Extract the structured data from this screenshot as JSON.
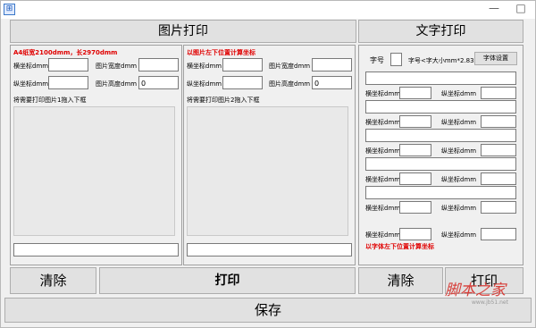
{
  "titlebar": {
    "icon_glyph": "⊞",
    "minimize": "—",
    "maximize": "□",
    "close": "✕"
  },
  "image_print": {
    "title": "图片打印",
    "left": {
      "note": "A4纸宽2100dmm，长2970dmm",
      "x_label": "横坐标dmm",
      "y_label": "纵坐标dmm",
      "w_label": "图片宽度dmm",
      "h_label": "图片高度dmm",
      "h_value": "0",
      "drop_label": "将需要打印图片1拖入下框"
    },
    "right": {
      "note": "以图片左下位置计算坐标",
      "x_label": "横坐标dmm",
      "y_label": "纵坐标dmm",
      "w_label": "图片宽度dmm",
      "h_label": "图片高度dmm",
      "h_value": "0",
      "drop_label": "将需要打印图片2拖入下框"
    }
  },
  "text_print": {
    "title": "文字打印",
    "font_label": "字号",
    "font_hint": "字号<字大小mm*2.835",
    "font_button": "字体设置",
    "x_label": "横坐标dmm",
    "y_label": "纵坐标dmm",
    "note": "以字体左下位置计算坐标"
  },
  "buttons": {
    "clear_left": "清除",
    "print_left": "打印",
    "clear_right": "清除",
    "print_right": "打印",
    "save": "保存"
  },
  "watermark": {
    "text": "脚本之家",
    "sub": "www.jb51.net"
  }
}
